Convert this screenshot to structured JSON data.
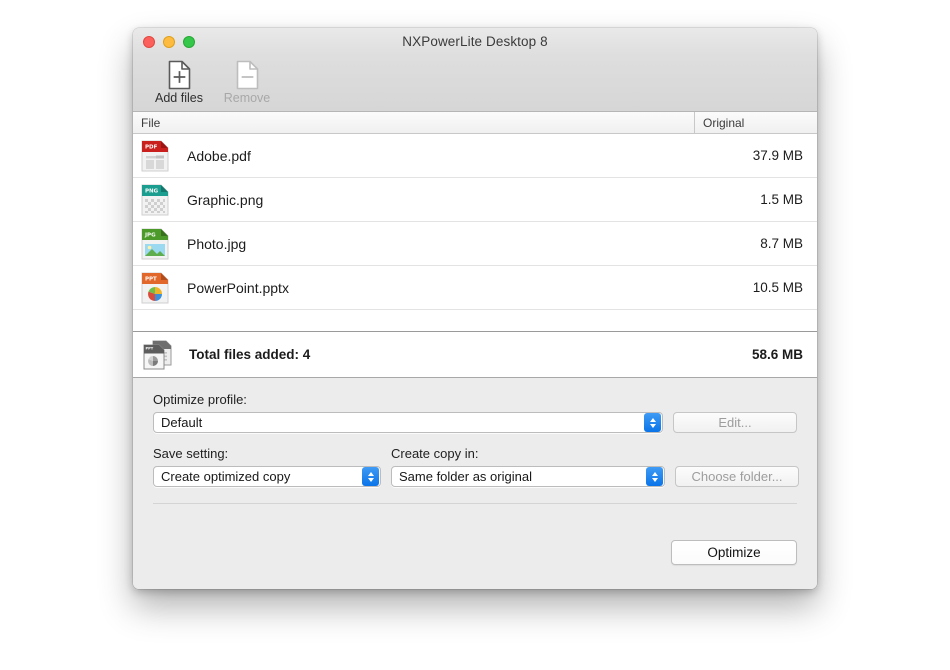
{
  "window": {
    "title": "NXPowerLite Desktop 8",
    "traffic_lights": [
      "close-button",
      "minimize-button",
      "zoom-button"
    ]
  },
  "toolbar": {
    "buttons": [
      {
        "label": "Add files",
        "icon": "document-plus-icon",
        "enabled": true
      },
      {
        "label": "Remove",
        "icon": "document-minus-icon",
        "enabled": false
      }
    ]
  },
  "file_table": {
    "columns": [
      "File",
      "Original"
    ],
    "rows": [
      {
        "name": "Adobe.pdf",
        "size": "37.9 MB",
        "icon": "pdf-file-icon",
        "type": "PDF"
      },
      {
        "name": "Graphic.png",
        "size": "1.5 MB",
        "icon": "png-file-icon",
        "type": "PNG"
      },
      {
        "name": "Photo.jpg",
        "size": "8.7 MB",
        "icon": "jpg-file-icon",
        "type": "JPG"
      },
      {
        "name": "PowerPoint.pptx",
        "size": "10.5 MB",
        "icon": "pptx-file-icon",
        "type": "PPT"
      }
    ]
  },
  "totals": {
    "label": "Total files added: 4",
    "size": "58.6 MB",
    "icon": "stacked-files-icon"
  },
  "settings": {
    "optimize_profile_label": "Optimize profile:",
    "optimize_profile_value": "Default",
    "edit_button": "Edit...",
    "save_setting_label": "Save setting:",
    "save_setting_value": "Create optimized copy",
    "create_copy_label": "Create copy in:",
    "create_copy_value": "Same folder as original",
    "choose_folder_button": "Choose folder..."
  },
  "footer": {
    "optimize_button": "Optimize"
  },
  "colors": {
    "accent_blue": "#0a74e8",
    "pdf_red": "#c9201d",
    "png_teal": "#1b9e8f",
    "jpg_green": "#4c9a2a",
    "ppt_orange": "#e2672a",
    "window_bg": "#ececec"
  }
}
